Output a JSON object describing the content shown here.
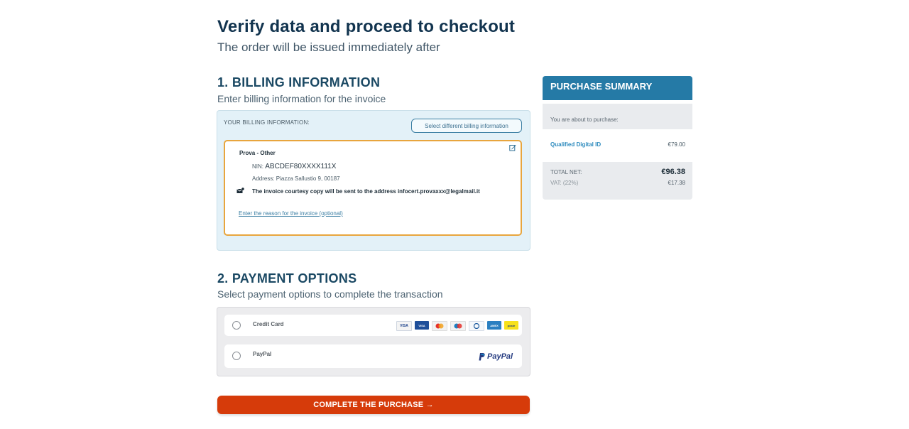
{
  "header": {
    "title": "Verify data and proceed to checkout",
    "subtitle": "The order will be issued immediately after"
  },
  "billing": {
    "title": "1. BILLING INFORMATION",
    "subtitle": "Enter billing information for the invoice",
    "section_label": "YOUR BILLING INFORMATION:",
    "select_button": "Select different billing information",
    "name": "Prova - Other",
    "nin_label": "NIN:",
    "nin_value": "ABCDEF80XXXX111X",
    "address": "Address: Piazza Sallustio 9, 00187",
    "courtesy_text": "The invoice courtesy copy will be sent to the address infocert.provaxxx@legalmail.it",
    "reason_link": "Enter the reason for the invoice (optional)"
  },
  "payment": {
    "title": "2. PAYMENT OPTIONS",
    "subtitle": "Select payment options to complete the transaction",
    "options": [
      {
        "label": "Credit Card",
        "selected": false,
        "icons": [
          "visa-logo",
          "visa-electron-logo",
          "mastercard-logo",
          "maestro-logo",
          "diners-logo",
          "amex-logo",
          "postepay-logo"
        ]
      },
      {
        "label": "PayPal",
        "selected": false,
        "icons": [
          "paypal-logo"
        ]
      }
    ],
    "card_logos": {
      "visa": "VISA",
      "electron": "VISA",
      "mastercard": "mc",
      "maestro": "mae",
      "diners": "D",
      "amex": "AMEX",
      "postepay": "poste"
    },
    "paypal_text": "PayPal"
  },
  "cta": {
    "label": "COMPLETE THE PURCHASE →"
  },
  "summary": {
    "title": "PURCHASE SUMMARY",
    "intro": "You are about to purchase:",
    "item_name": "Qualified Digital ID",
    "item_price": "€79.00",
    "total_label": "TOTAL NET:",
    "total_value": "€96.38",
    "vat_label": "VAT: (22%)",
    "vat_value": "€17.38"
  },
  "colors": {
    "heading": "#12344f",
    "accent": "#257aa6",
    "cta": "#d63b0a",
    "card_border": "#e8a53d"
  }
}
